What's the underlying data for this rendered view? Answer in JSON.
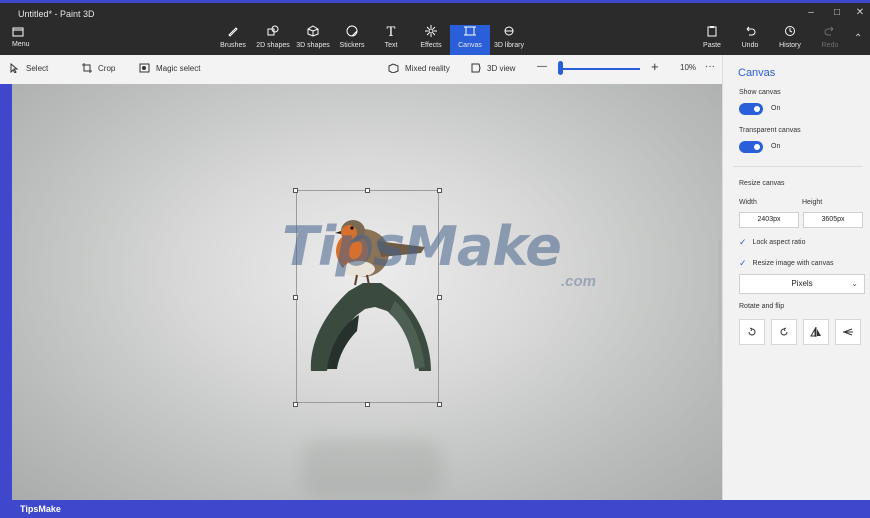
{
  "window": {
    "title": "Untitled* - Paint 3D",
    "controls": {
      "minimize": "–",
      "maximize": "□",
      "close": "✕"
    }
  },
  "toolbar": {
    "menu_label": "Menu",
    "tools": [
      {
        "label": "Brushes",
        "icon": "brush-icon"
      },
      {
        "label": "2D shapes",
        "icon": "2d-shapes-icon"
      },
      {
        "label": "3D shapes",
        "icon": "3d-shapes-icon"
      },
      {
        "label": "Stickers",
        "icon": "stickers-icon"
      },
      {
        "label": "Text",
        "icon": "text-icon"
      },
      {
        "label": "Effects",
        "icon": "effects-icon"
      },
      {
        "label": "Canvas",
        "icon": "canvas-icon",
        "active": true
      },
      {
        "label": "3D library",
        "icon": "3d-library-icon"
      }
    ],
    "right_tools": [
      {
        "label": "Paste",
        "icon": "paste-icon"
      },
      {
        "label": "Undo",
        "icon": "undo-icon"
      },
      {
        "label": "History",
        "icon": "history-icon"
      },
      {
        "label": "Redo",
        "icon": "redo-icon",
        "disabled": true
      }
    ]
  },
  "subbar": {
    "select_label": "Select",
    "crop_label": "Crop",
    "magic_select_label": "Magic select",
    "mixed_reality_label": "Mixed reality",
    "view3d_label": "3D view",
    "zoom_minus": "—",
    "zoom_plus": "+",
    "zoom_value": "10%",
    "more": "···"
  },
  "canvas": {
    "watermark": "TipsMake",
    "watermark_suffix": ".com"
  },
  "panel": {
    "title": "Canvas",
    "show_canvas_label": "Show canvas",
    "show_canvas_state": "On",
    "transparent_canvas_label": "Transparent canvas",
    "transparent_canvas_state": "On",
    "resize_label": "Resize canvas",
    "width_label": "Width",
    "height_label": "Height",
    "width_value": "2403px",
    "height_value": "3605px",
    "lock_aspect_label": "Lock aspect ratio",
    "resize_image_label": "Resize image with canvas",
    "unit_value": "Pixels",
    "rotate_flip_label": "Rotate and flip"
  },
  "statusbar": {
    "brand": "TipsMake"
  },
  "colors": {
    "accent": "#2b5fd9",
    "titlebar": "#2b2b2b",
    "frame": "#3f48cc"
  }
}
